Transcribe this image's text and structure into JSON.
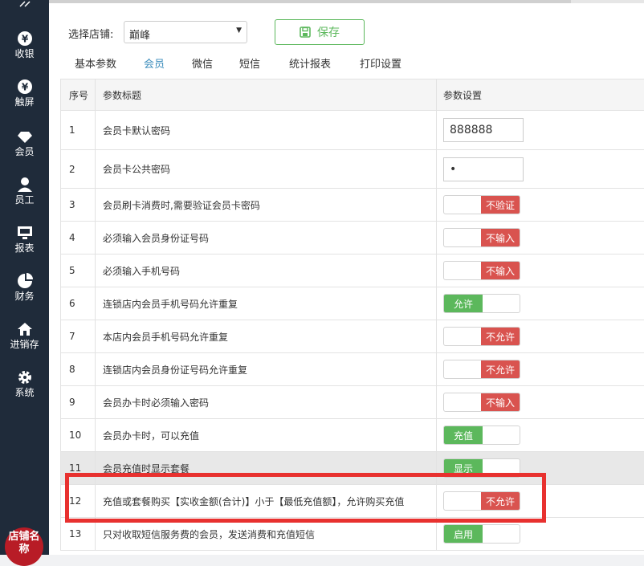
{
  "sidebar": {
    "items": [
      {
        "label": "收银",
        "icon": "yen-icon"
      },
      {
        "label": "触屏",
        "icon": "yen-icon"
      },
      {
        "label": "会员",
        "icon": "diamond-icon"
      },
      {
        "label": "员工",
        "icon": "user-icon"
      },
      {
        "label": "报表",
        "icon": "monitor-icon"
      },
      {
        "label": "财务",
        "icon": "pie-icon"
      },
      {
        "label": "进销存",
        "icon": "home-icon"
      },
      {
        "label": "系统",
        "icon": "gear-icon"
      }
    ],
    "shop_badge": "店铺名称"
  },
  "store": {
    "label": "选择店铺:",
    "value": "巅峰"
  },
  "save_label": "保存",
  "tabs": [
    "基本参数",
    "会员",
    "微信",
    "短信",
    "统计报表",
    "打印设置"
  ],
  "active_tab": "会员",
  "table": {
    "headers": [
      "序号",
      "参数标题",
      "参数设置"
    ],
    "rows": [
      {
        "no": "1",
        "title": "会员卡默认密码",
        "type": "input",
        "value": "888888"
      },
      {
        "no": "2",
        "title": "会员卡公共密码",
        "type": "input",
        "value": "•"
      },
      {
        "no": "3",
        "title": "会员刷卡消费时,需要验证会员卡密码",
        "type": "off",
        "value": "不验证"
      },
      {
        "no": "4",
        "title": "必须输入会员身份证号码",
        "type": "off",
        "value": "不输入"
      },
      {
        "no": "5",
        "title": "必须输入手机号码",
        "type": "off",
        "value": "不输入"
      },
      {
        "no": "6",
        "title": "连锁店内会员手机号码允许重复",
        "type": "on",
        "value": "允许"
      },
      {
        "no": "7",
        "title": "本店内会员手机号码允许重复",
        "type": "off",
        "value": "不允许"
      },
      {
        "no": "8",
        "title": "连锁店内会员身份证号码允许重复",
        "type": "off",
        "value": "不允许"
      },
      {
        "no": "9",
        "title": "会员办卡时必须输入密码",
        "type": "off",
        "value": "不输入"
      },
      {
        "no": "10",
        "title": "会员办卡时，可以充值",
        "type": "on",
        "value": "充值"
      },
      {
        "no": "11",
        "title": "会员充值时显示套餐",
        "type": "on",
        "value": "显示"
      },
      {
        "no": "12",
        "title": "充值或套餐购买【实收金额(合计)】小于【最低充值额】，允许购买充值",
        "type": "off",
        "value": "不允许"
      },
      {
        "no": "13",
        "title": "只对收取短信服务费的会员，发送消费和充值短信",
        "type": "on",
        "value": "启用"
      }
    ]
  },
  "colors": {
    "sidebar": "#1f2b3a",
    "accent": "#3c8dbc",
    "on": "#5cb85c",
    "off": "#d9534f",
    "highlight_box": "#e8312f"
  }
}
